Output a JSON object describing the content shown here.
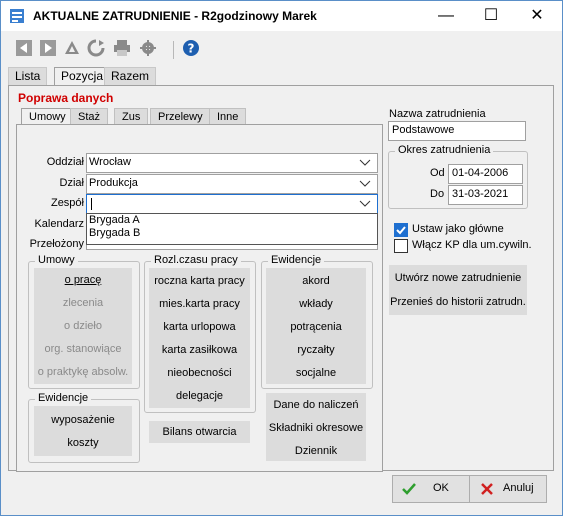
{
  "window": {
    "title": "AKTUALNE ZATRUDNIENIE - R2godzinowy Marek"
  },
  "title_buttons": {
    "minimize": "—",
    "maximize": "☐",
    "close": "✕"
  },
  "toolbar": [
    "back-icon",
    "forward-icon",
    "filter-icon",
    "refresh-icon",
    "print-icon",
    "settings-icon",
    "help-icon"
  ],
  "top_tabs": [
    "Lista",
    "Pozycja",
    "Razem"
  ],
  "section_title": "Poprawa danych",
  "inner_tabs": [
    "Umowy",
    "Staż",
    "Zus",
    "Przelewy",
    "Inne"
  ],
  "form": {
    "oddzial": {
      "label": "Oddział",
      "value": "Wrocław"
    },
    "dzial": {
      "label": "Dział",
      "value": "Produkcja"
    },
    "zespol": {
      "label": "Zespół",
      "value": ""
    },
    "kalendarz": {
      "label": "Kalendarz"
    },
    "przelozony": {
      "label": "Przełożony"
    }
  },
  "dropdown_options": [
    "Brygada A",
    "Brygada B"
  ],
  "umowy": {
    "title": "Umowy",
    "items": [
      "o pracę",
      "zlecenia",
      "o dzieło",
      "org. stanowiące",
      "o praktykę absolw."
    ]
  },
  "rozl": {
    "title": "Rozl.czasu pracy",
    "items": [
      "roczna karta pracy",
      "mies.karta pracy",
      "karta urlopowa",
      "karta zasiłkowa",
      "nieobecności",
      "delegacje"
    ]
  },
  "ewidencje": {
    "title": "Ewidencje",
    "items": [
      "akord",
      "wkłady",
      "potrącenia",
      "ryczałty",
      "socjalne"
    ]
  },
  "ewidencje2": {
    "title": "Ewidencje",
    "items": [
      "wyposażenie",
      "koszty"
    ]
  },
  "bilans": "Bilans otwarcia",
  "dane": {
    "items": [
      "Dane do naliczeń",
      "Składniki okresowe",
      "Dziennik"
    ]
  },
  "right": {
    "nazwa_label": "Nazwa zatrudnienia",
    "nazwa_value": "Podstawowe",
    "okres_title": "Okres zatrudnienia",
    "od_label": "Od",
    "od_value": "01-04-2006",
    "do_label": "Do",
    "do_value": "31-03-2021",
    "chk1_label": "Ustaw jako główne",
    "chk1_checked": true,
    "chk2_label": "Włącz KP dla um.cywiln.",
    "chk2_checked": false,
    "btn_utworz": "Utwórz nowe zatrudnienie",
    "btn_przenies": "Przenieś do historii zatrudn."
  },
  "buttons": {
    "ok": "OK",
    "anuluj": "Anuluj"
  },
  "colors": {
    "accent": "#1e6fd0",
    "red": "#d00000",
    "ok_green": "#2e9e2e",
    "cancel_red": "#d02020"
  }
}
